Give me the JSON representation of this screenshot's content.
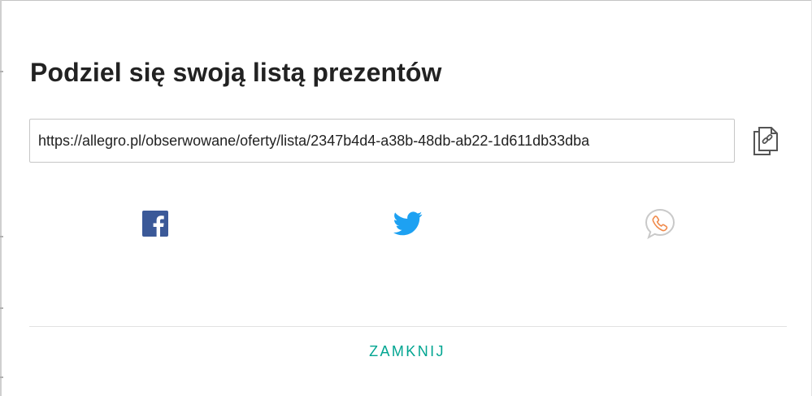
{
  "dialog": {
    "title": "Podziel się swoją listą prezentów",
    "share_url": "https://allegro.pl/obserwowane/oferty/lista/2347b4d4-a38b-48db-ab22-1d611db33dba",
    "copy_icon": "copy-link-icon",
    "share_icons": [
      "facebook-icon",
      "twitter-icon",
      "phone-chat-icon"
    ],
    "close_label": "ZAMKNIJ"
  },
  "colors": {
    "facebook": "#3b5998",
    "twitter": "#1da1f2",
    "phone_accent": "#f08a4b",
    "close_text": "#00a591",
    "title_text": "#222222"
  }
}
